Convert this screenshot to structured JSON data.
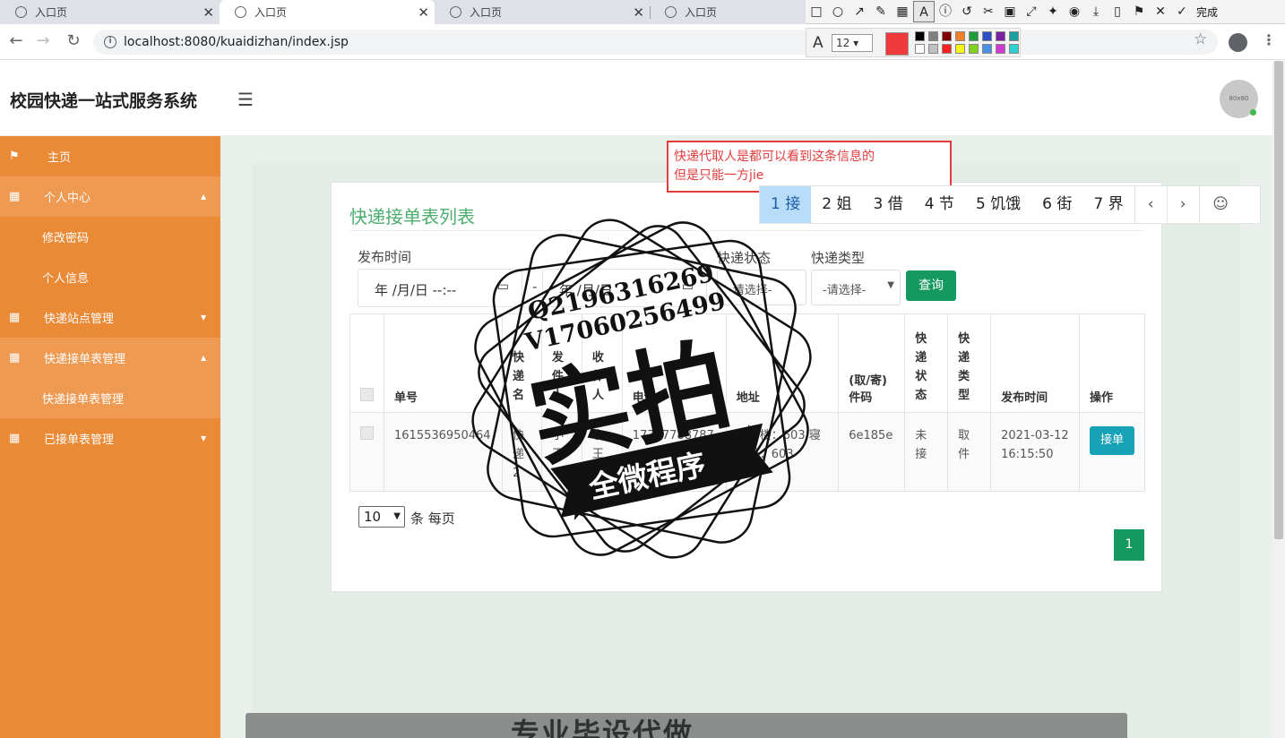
{
  "browser": {
    "tabs": [
      {
        "title": "入口页",
        "active": false
      },
      {
        "title": "入口页",
        "active": true
      },
      {
        "title": "入口页",
        "active": false
      },
      {
        "title": "入口页",
        "active": false
      }
    ],
    "url": "localhost:8080/kuaidizhan/index.jsp"
  },
  "annotation_tool": {
    "done_label": "完成",
    "font_size": "12",
    "current_color": "#ef3b3b",
    "palette": [
      "#000000",
      "#808080",
      "#800000",
      "#f07f28",
      "#1f9d3a",
      "#2d50c8",
      "#7b1fa2",
      "#1a9e9e",
      "#ffffff",
      "#c0c0c0",
      "#ff2020",
      "#f5f51a",
      "#7ed321",
      "#4a90e2",
      "#d13ad1",
      "#2ed1d1"
    ],
    "text_box": {
      "line1": "快递代取人是都可以看到这条信息的",
      "line2": "但是只能一方jie"
    }
  },
  "ime": {
    "candidates": [
      "1 接",
      "2 姐",
      "3 借",
      "4 节",
      "5 饥饿",
      "6 街",
      "7 界"
    ]
  },
  "header": {
    "title": "校园快递一站式服务系统",
    "avatar_text": "80x80"
  },
  "sidebar": {
    "items": [
      {
        "label": "主页",
        "icon": "flag-icon"
      },
      {
        "label": "个人中心",
        "icon": "grid-icon"
      },
      {
        "label": "修改密码"
      },
      {
        "label": "个人信息"
      },
      {
        "label": "快递站点管理",
        "icon": "grid-icon"
      },
      {
        "label": "快递接单表管理",
        "icon": "grid-icon"
      },
      {
        "label": "快递接单表管理"
      },
      {
        "label": "已接单表管理",
        "icon": "grid-icon"
      }
    ]
  },
  "main": {
    "title": "快递接单表列表",
    "filters": {
      "publish_time_label": "发布时间",
      "date_placeholder_1": "年 /月/日 --:--",
      "date_placeholder_2": "年 /月/日",
      "range_sep": "-",
      "status_label": "快递状态",
      "status_value": "-请选择-",
      "type_label": "快递类型",
      "type_value": "-请选择-",
      "query_button": "查询"
    },
    "table": {
      "headers": [
        "单号",
        "快递名",
        "发件人",
        "收件人",
        "电话",
        "地址",
        "(取/寄)件码",
        "快递状态",
        "快递类型",
        "发布时间",
        "操作"
      ],
      "rows": [
        {
          "order_no": "1615536950464",
          "express_name": "快递2",
          "sender": "小王",
          "receiver": "小王",
          "phone": "17787788787",
          "address": "宿舍楼：603 寝室号：603",
          "code": "6e185e",
          "status": "未接",
          "type": "取件",
          "time": "2021-03-12 16:15:50",
          "action": "接单"
        }
      ]
    },
    "pagination": {
      "page_size": "10",
      "page_size_suffix": "条 每页",
      "current_page": "1"
    }
  },
  "watermark": {
    "qq": "Q2196316269",
    "vx": "V17060256499",
    "big": "实拍",
    "banner": "全微程序",
    "bottom_text": "专业毕设代做"
  }
}
